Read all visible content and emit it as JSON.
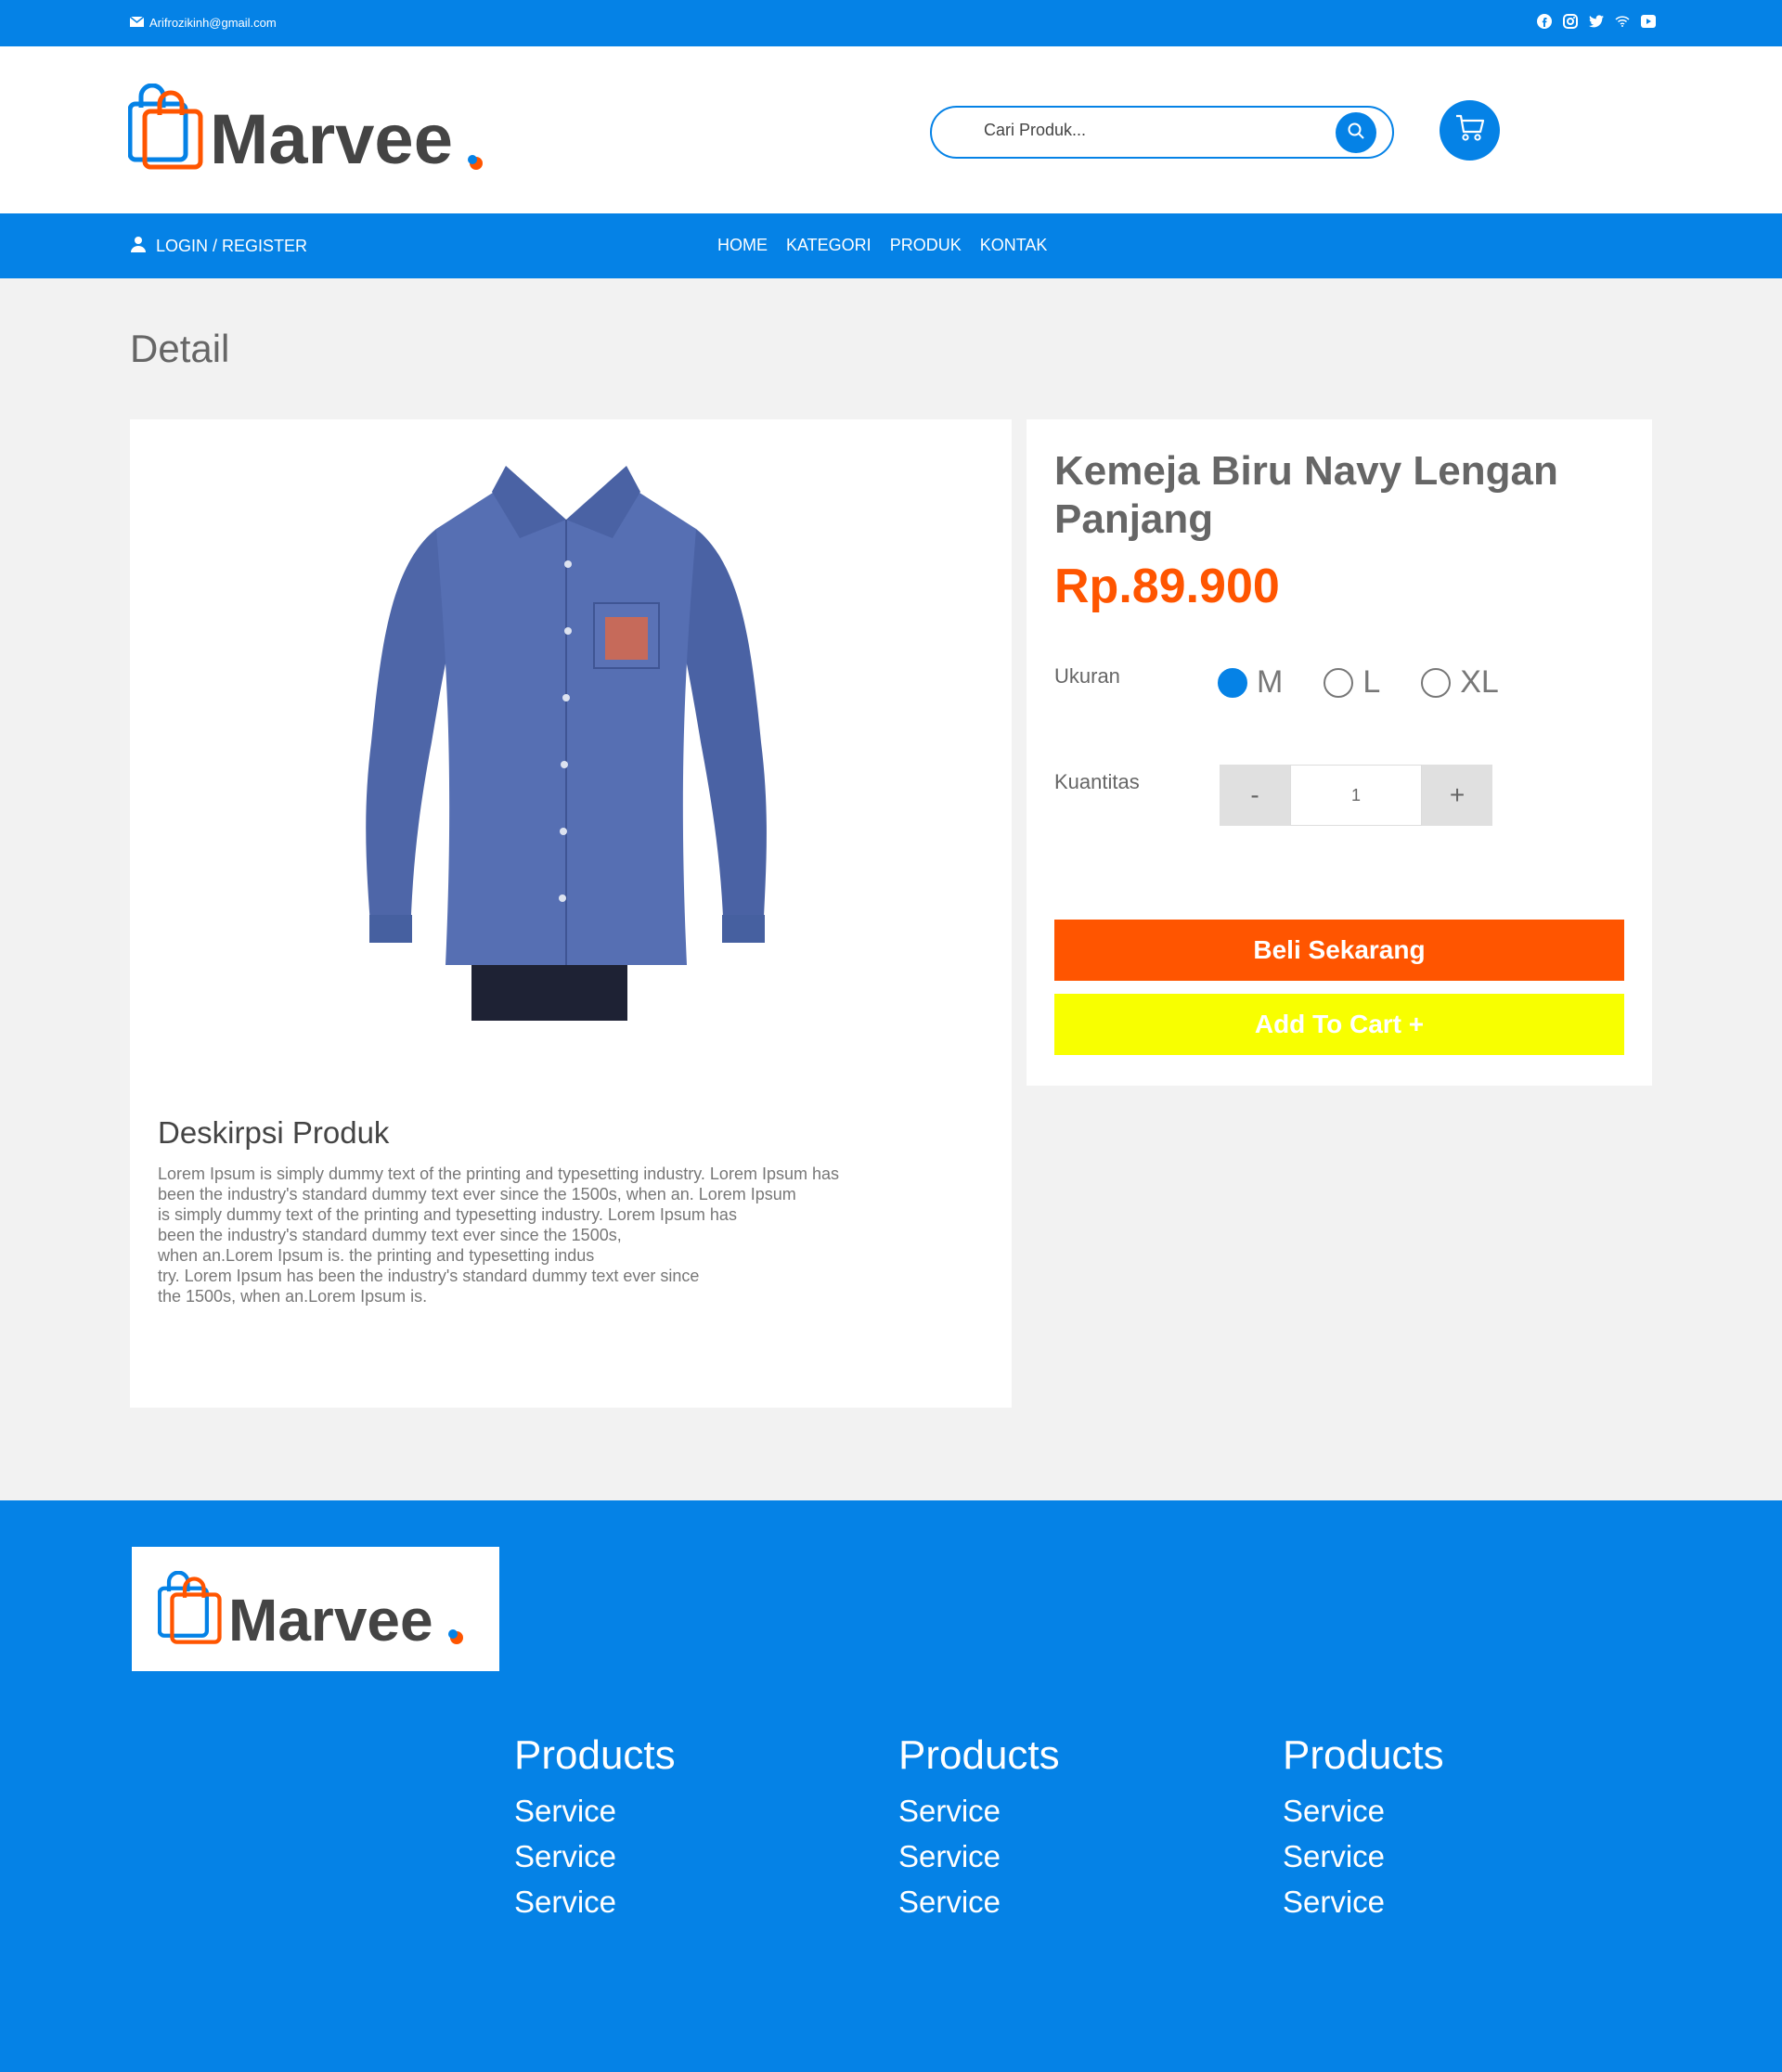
{
  "topbar": {
    "email": "Arifrozikinh@gmail.com",
    "socials": [
      "facebook-icon",
      "instagram-icon",
      "twitter-icon",
      "wifi-icon",
      "youtube-icon"
    ]
  },
  "header": {
    "brand": "Marvee",
    "search_placeholder": "Cari Produk..."
  },
  "nav": {
    "login": "LOGIN / REGISTER",
    "items": [
      "HOME",
      "KATEGORI",
      "PRODUK",
      "KONTAK"
    ]
  },
  "page": {
    "title": "Detail"
  },
  "product": {
    "name": "Kemeja Biru Navy Lengan Panjang",
    "price": "Rp.89.900",
    "size_label": "Ukuran",
    "sizes": [
      "M",
      "L",
      "XL"
    ],
    "selected_size": "M",
    "qty_label": "Kuantitas",
    "qty_minus": "-",
    "qty_value": "1",
    "qty_plus": "+",
    "buy_label": "Beli Sekarang",
    "cart_label": "Add To Cart +",
    "desc_title": "Deskirpsi Produk",
    "desc_text": "Lorem Ipsum is simply dummy text of the printing and typesetting industry. Lorem Ipsum has\nbeen the industry's standard dummy text ever since the 1500s, when an. Lorem Ipsum\nis simply dummy text of the printing and typesetting industry. Lorem Ipsum has\nbeen the industry's standard dummy text ever since the 1500s,\nwhen an.Lorem Ipsum is. the printing and typesetting indus\ntry. Lorem Ipsum has been the industry's standard dummy text ever since\nthe 1500s, when an.Lorem Ipsum is."
  },
  "footer": {
    "brand": "Marvee",
    "columns": [
      {
        "title": "Products",
        "links": [
          "Service",
          "Service",
          "Service"
        ]
      },
      {
        "title": "Products",
        "links": [
          "Service",
          "Service",
          "Service"
        ]
      },
      {
        "title": "Products",
        "links": [
          "Service",
          "Service",
          "Service"
        ]
      }
    ]
  },
  "colors": {
    "primary": "#0582e6",
    "accent": "#ff5500",
    "cart_button": "#f8ff00"
  }
}
